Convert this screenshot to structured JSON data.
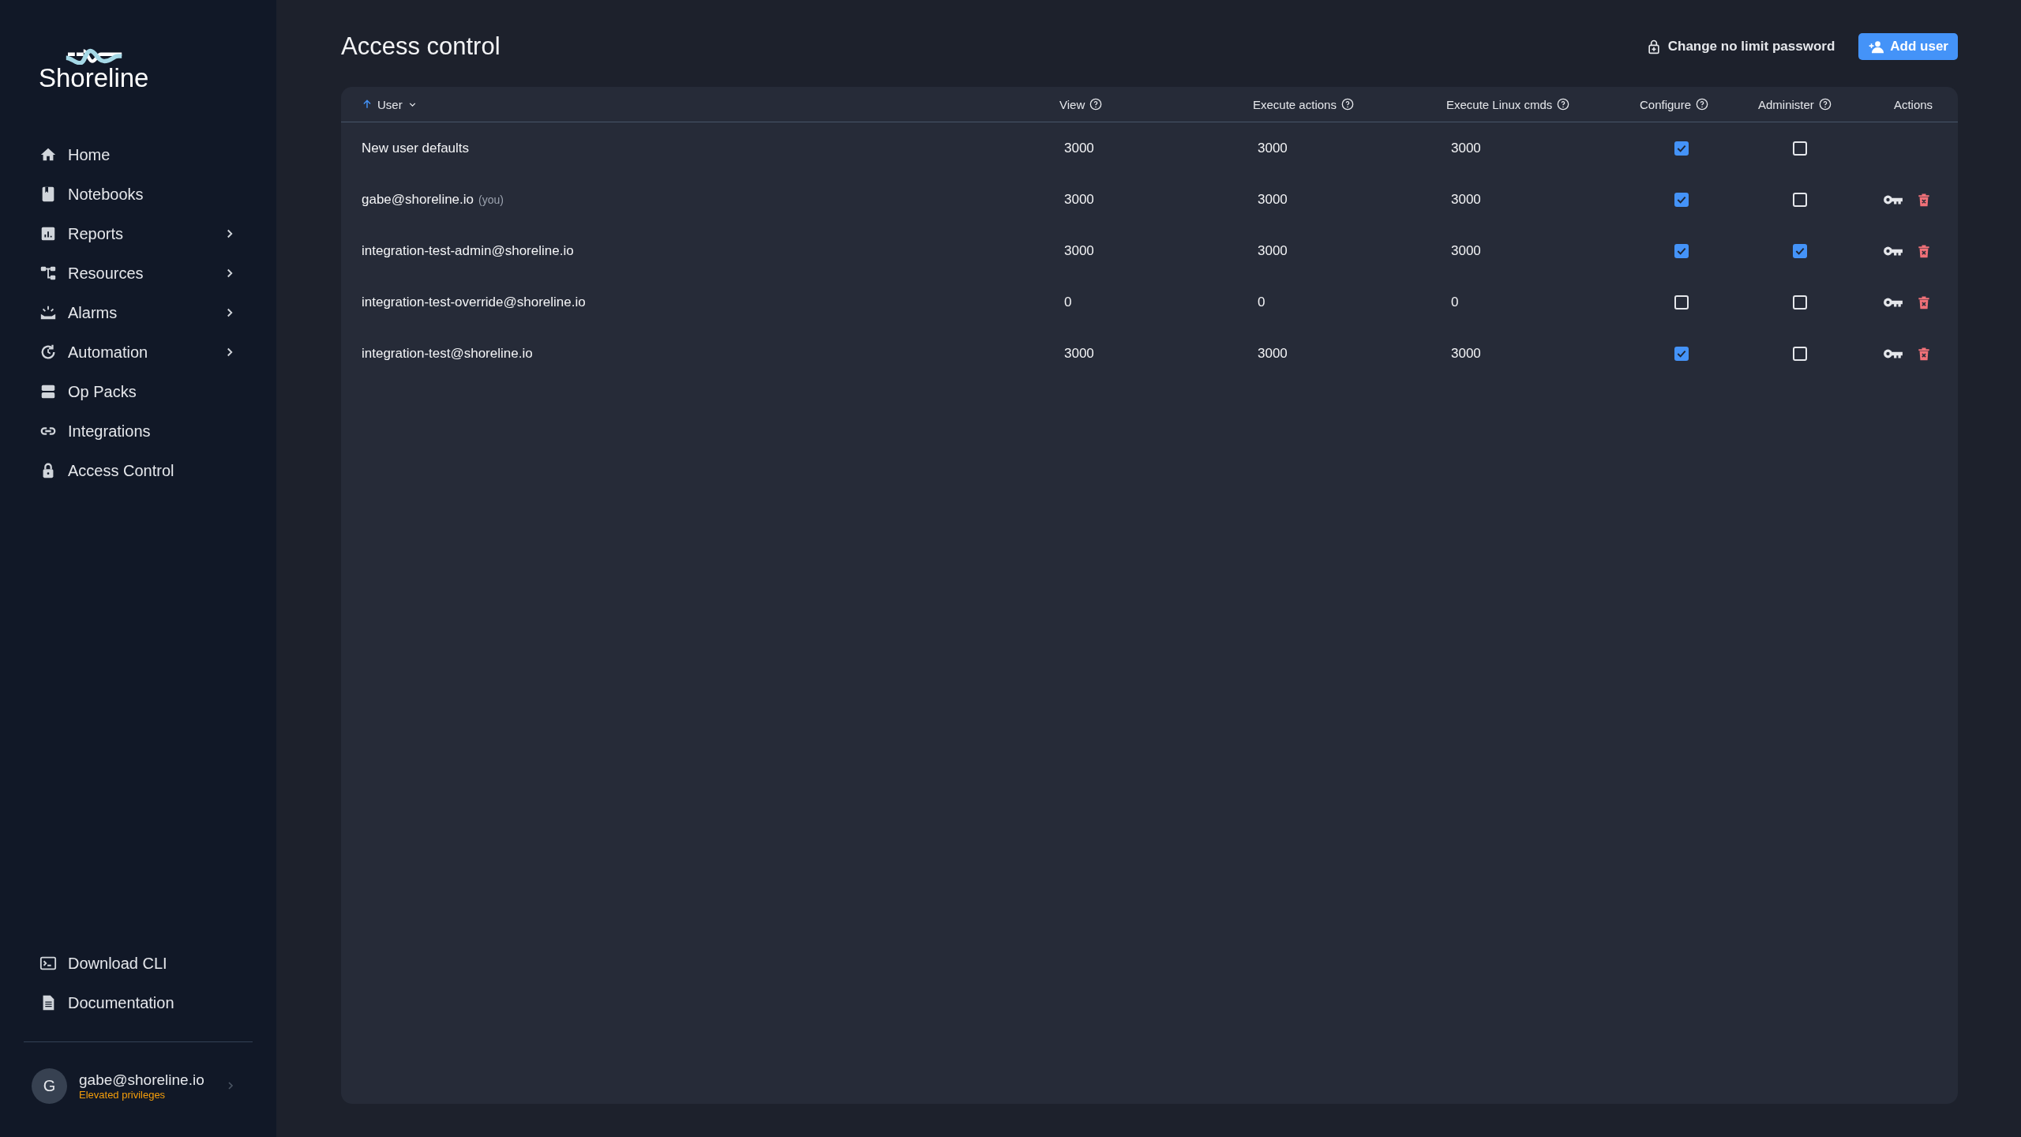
{
  "sidebar": {
    "logo": "Shoreline",
    "nav": [
      {
        "label": "Home",
        "expandable": false
      },
      {
        "label": "Notebooks",
        "expandable": false
      },
      {
        "label": "Reports",
        "expandable": true
      },
      {
        "label": "Resources",
        "expandable": true
      },
      {
        "label": "Alarms",
        "expandable": true
      },
      {
        "label": "Automation",
        "expandable": true
      },
      {
        "label": "Op Packs",
        "expandable": false
      },
      {
        "label": "Integrations",
        "expandable": false
      },
      {
        "label": "Access Control",
        "expandable": false
      }
    ],
    "footer_nav": [
      {
        "label": "Download CLI"
      },
      {
        "label": "Documentation"
      }
    ],
    "user": {
      "avatar": "G",
      "email": "gabe@shoreline.io",
      "role": "Elevated privileges"
    }
  },
  "header": {
    "title": "Access control",
    "actions": [
      {
        "label": "Change no limit password",
        "kind": "link"
      },
      {
        "label": "Add user",
        "kind": "primary"
      }
    ]
  },
  "table": {
    "columns": [
      {
        "label": "User",
        "kind": "sort"
      },
      {
        "label": "View",
        "kind": "help"
      },
      {
        "label": "Execute actions",
        "kind": "help"
      },
      {
        "label": "Execute Linux cmds",
        "kind": "help"
      },
      {
        "label": "Configure",
        "kind": "help"
      },
      {
        "label": "Administer",
        "kind": "help"
      },
      {
        "label": "Actions",
        "kind": "plain"
      }
    ],
    "rows": [
      {
        "user": "New user defaults",
        "view": "3000",
        "execute_actions": "3000",
        "execute_linux_cmds": "3000",
        "configure": true,
        "administer": false,
        "has_actions": false
      },
      {
        "user": "gabe@shoreline.io",
        "note": "(you)",
        "view": "3000",
        "execute_actions": "3000",
        "execute_linux_cmds": "3000",
        "configure": true,
        "administer": false,
        "has_actions": true
      },
      {
        "user": "integration-test-admin@shoreline.io",
        "view": "3000",
        "execute_actions": "3000",
        "execute_linux_cmds": "3000",
        "configure": true,
        "administer": true,
        "has_actions": true
      },
      {
        "user": "integration-test-override@shoreline.io",
        "view": "0",
        "execute_actions": "0",
        "execute_linux_cmds": "0",
        "configure": false,
        "administer": false,
        "has_actions": true
      },
      {
        "user": "integration-test@shoreline.io",
        "view": "3000",
        "execute_actions": "3000",
        "execute_linux_cmds": "3000",
        "configure": true,
        "administer": false,
        "has_actions": true
      }
    ]
  }
}
